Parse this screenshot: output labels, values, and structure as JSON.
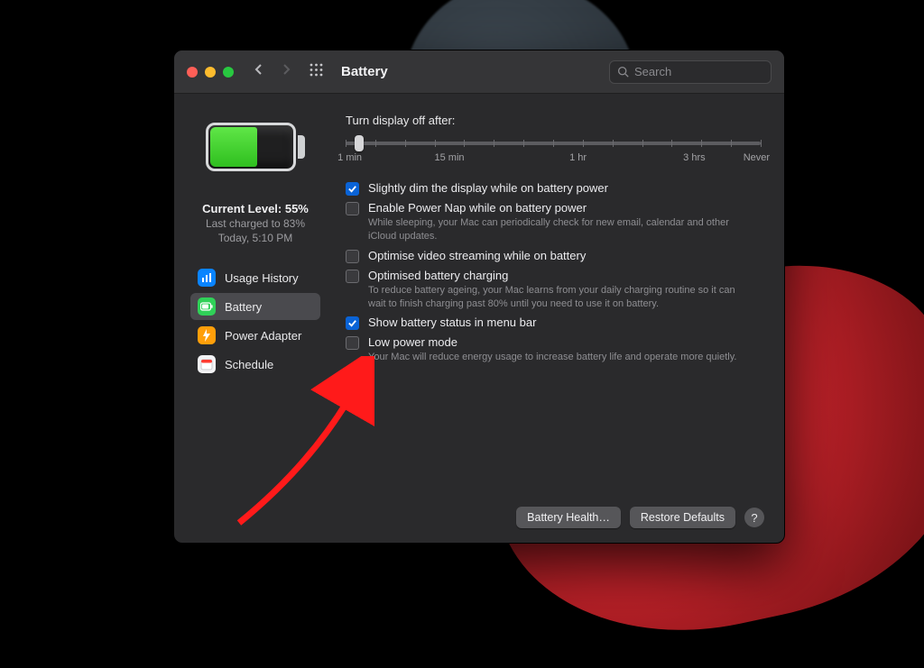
{
  "window": {
    "title": "Battery",
    "search_placeholder": "Search"
  },
  "sidebar": {
    "battery_icon_fill_percent": 55,
    "status": {
      "current_level_label": "Current Level: 55%",
      "last_charged_label": "Last charged to 83%",
      "timestamp_label": "Today, 5:10 PM"
    },
    "items": [
      {
        "id": "usage-history",
        "label": "Usage History",
        "icon": "chart-icon",
        "color": "blue"
      },
      {
        "id": "battery",
        "label": "Battery",
        "icon": "battery-icon",
        "color": "green",
        "selected": true
      },
      {
        "id": "power-adapter",
        "label": "Power Adapter",
        "icon": "bolt-icon",
        "color": "orange"
      },
      {
        "id": "schedule",
        "label": "Schedule",
        "icon": "calendar-icon",
        "color": "white"
      }
    ]
  },
  "slider": {
    "label": "Turn display off after:",
    "ticks": [
      "1 min",
      "15 min",
      "1 hr",
      "3 hrs",
      "Never"
    ]
  },
  "options": [
    {
      "id": "dim",
      "checked": true,
      "title": "Slightly dim the display while on battery power"
    },
    {
      "id": "powernap",
      "checked": false,
      "title": "Enable Power Nap while on battery power",
      "desc": "While sleeping, your Mac can periodically check for new email, calendar and other iCloud updates."
    },
    {
      "id": "video",
      "checked": false,
      "title": "Optimise video streaming while on battery"
    },
    {
      "id": "optchg",
      "checked": false,
      "title": "Optimised battery charging",
      "desc": "To reduce battery ageing, your Mac learns from your daily charging routine so it can wait to finish charging past 80% until you need to use it on battery."
    },
    {
      "id": "menubar",
      "checked": true,
      "title": "Show battery status in menu bar"
    },
    {
      "id": "lowpower",
      "checked": false,
      "title": "Low power mode",
      "desc": "Your Mac will reduce energy usage to increase battery life and operate more quietly."
    }
  ],
  "footer": {
    "battery_health": "Battery Health…",
    "restore_defaults": "Restore Defaults",
    "help": "?"
  }
}
